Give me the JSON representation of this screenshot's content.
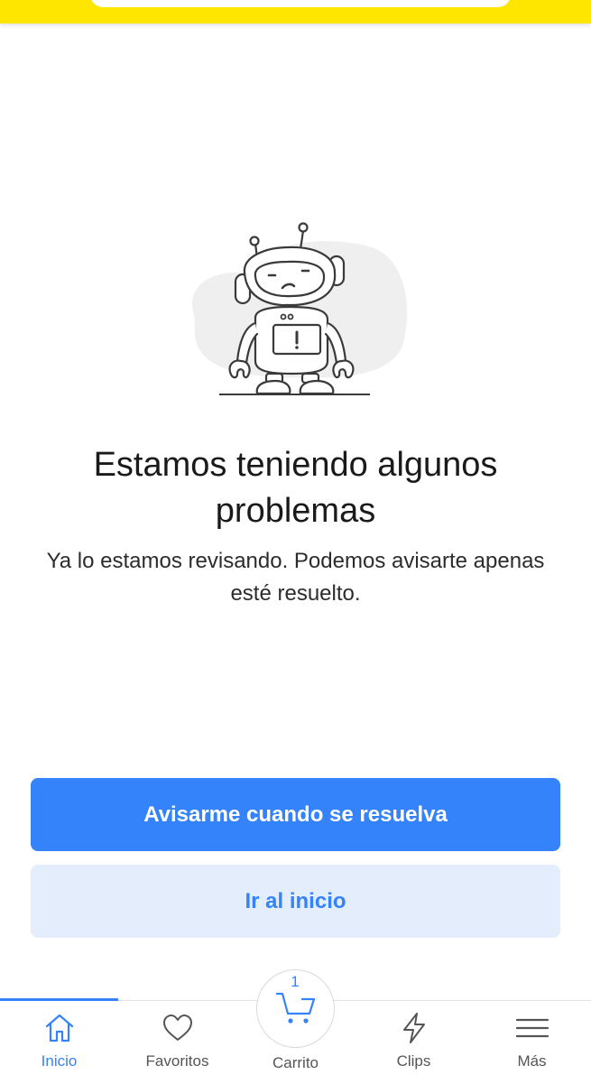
{
  "error": {
    "title": "Estamos teniendo algunos problemas",
    "message": "Ya lo estamos revisando. Podemos avisarte apenas esté resuelto."
  },
  "actions": {
    "notify_label": "Avisarme cuando se resuelva",
    "home_label": "Ir al inicio"
  },
  "tabbar": {
    "items": [
      {
        "label": "Inicio",
        "icon": "home-icon",
        "active": true
      },
      {
        "label": "Favoritos",
        "icon": "heart-icon",
        "active": false
      },
      {
        "label": "Carrito",
        "icon": "cart-icon",
        "active": false,
        "count": "1"
      },
      {
        "label": "Clips",
        "icon": "lightning-icon",
        "active": false
      },
      {
        "label": "Más",
        "icon": "menu-icon",
        "active": false
      }
    ]
  },
  "colors": {
    "brand_yellow": "#ffe600",
    "accent_blue": "#3483fa",
    "secondary_bg": "#e3edfb"
  }
}
